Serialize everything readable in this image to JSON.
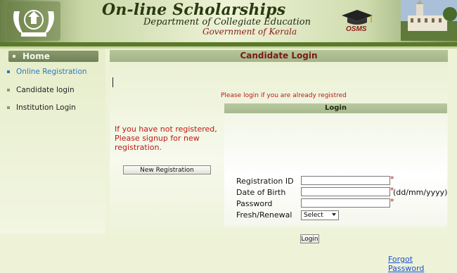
{
  "header": {
    "title": "On-line Scholarships",
    "department": "Department of Collegiate Education",
    "government": "Government of Kerala",
    "osms_logo": "OSMS"
  },
  "sidebar": {
    "home_label": "Home",
    "items": [
      {
        "label": "Online Registration",
        "active": true
      },
      {
        "label": "Candidate login",
        "active": false
      },
      {
        "label": "Institution Login",
        "active": false
      }
    ]
  },
  "main": {
    "heading": "Candidate Login",
    "notice": "Please login if you are already registred",
    "register_message": "If you have not registered, Please signup for new registration.",
    "new_registration_button": "New Registration"
  },
  "login": {
    "heading": "Login",
    "fields": {
      "registration_id": {
        "label": "Registration ID",
        "value": "",
        "required_mark": "*"
      },
      "date_of_birth": {
        "label": "Date of Birth",
        "value": "",
        "required_mark": "*",
        "hint": "(dd/mm/yyyy)"
      },
      "password": {
        "label": "Password",
        "value": "",
        "required_mark": "*"
      },
      "fresh_renewal": {
        "label": "Fresh/Renewal",
        "selected": "Select"
      }
    },
    "login_button": "Login",
    "forgot_password": "Forgot Password"
  },
  "colors": {
    "accent_red": "#c01818",
    "link_blue": "#1a4ed0",
    "header_green": "#5a7a2a",
    "active_blue": "#2a7ac0"
  },
  "icons": [
    "kerala-emblem-icon",
    "osms-mortarboard-icon",
    "college-building-image",
    "graduation-cap-watermark"
  ]
}
